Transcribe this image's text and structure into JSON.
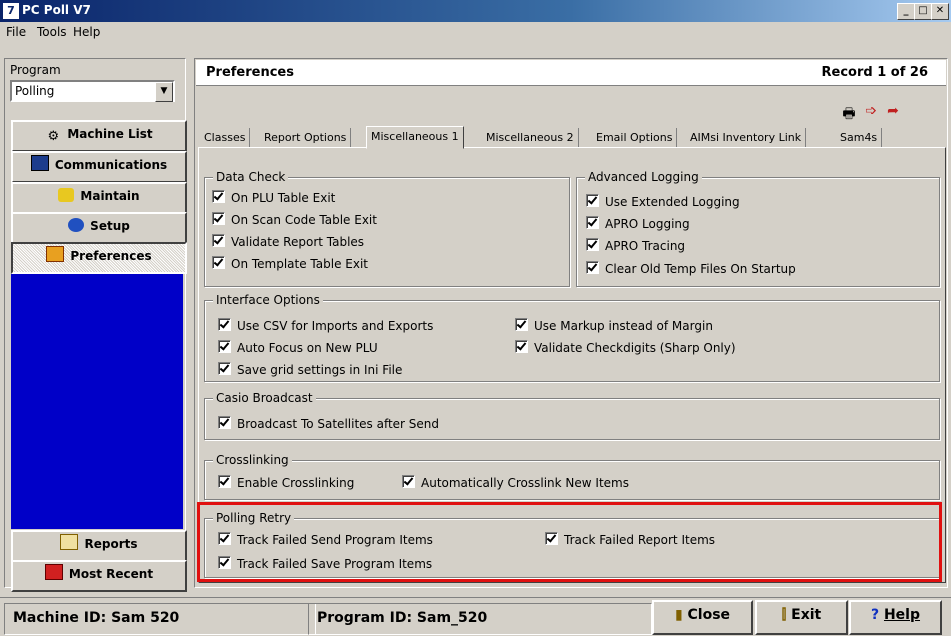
{
  "window": {
    "title": "PC Poll V7",
    "icon_text": "7"
  },
  "window_buttons": {
    "minimize": "_",
    "maximize": "□",
    "close": "✕"
  },
  "menu": {
    "file": "File",
    "tools": "Tools",
    "help": "Help"
  },
  "left": {
    "program_label": "Program",
    "program_value": "Polling",
    "nav": [
      {
        "label": "Machine List"
      },
      {
        "label": "Communications"
      },
      {
        "label": "Maintain"
      },
      {
        "label": "Setup"
      },
      {
        "label": "Preferences"
      },
      {
        "label": "Reports"
      },
      {
        "label": "Most Recent"
      }
    ]
  },
  "header": {
    "title": "Preferences",
    "record": "Record  1  of  26"
  },
  "tabs": [
    {
      "label": "Classes"
    },
    {
      "label": "Report Options"
    },
    {
      "label": "Miscellaneous 1"
    },
    {
      "label": "Miscellaneous 2"
    },
    {
      "label": "Email Options"
    },
    {
      "label": "AIMsi Inventory Link"
    },
    {
      "label": "Sam4s"
    }
  ],
  "groups": {
    "data_check": {
      "title": "Data Check",
      "items": [
        "On PLU Table Exit",
        "On Scan Code Table Exit",
        "Validate Report Tables",
        "On Template Table Exit"
      ]
    },
    "advanced_logging": {
      "title": "Advanced Logging",
      "items": [
        "Use Extended Logging",
        "APRO Logging",
        "APRO Tracing",
        "Clear Old Temp Files On Startup"
      ]
    },
    "interface": {
      "title": "Interface Options",
      "items": [
        "Use CSV for Imports and Exports",
        "Auto Focus on New PLU",
        "Save grid settings in Ini File",
        "Use Markup instead of Margin",
        "Validate Checkdigits (Sharp Only)"
      ]
    },
    "casio": {
      "title": "Casio Broadcast",
      "items": [
        "Broadcast To Satellites after Send"
      ]
    },
    "crosslinking": {
      "title": "Crosslinking",
      "items": [
        "Enable Crosslinking",
        "Automatically Crosslink New Items"
      ]
    },
    "polling_retry": {
      "title": "Polling Retry",
      "items": [
        "Track Failed Send Program Items",
        "Track Failed Save Program Items",
        "Track Failed Report Items"
      ]
    }
  },
  "status": {
    "machine_id": "Machine ID: Sam 520",
    "program_id": "Program ID: Sam_520"
  },
  "buttons": {
    "close": "Close",
    "exit": "Exit",
    "help": "Help"
  },
  "colors": {
    "highlight": "#e01010",
    "nav_fill": "#0000c8"
  }
}
